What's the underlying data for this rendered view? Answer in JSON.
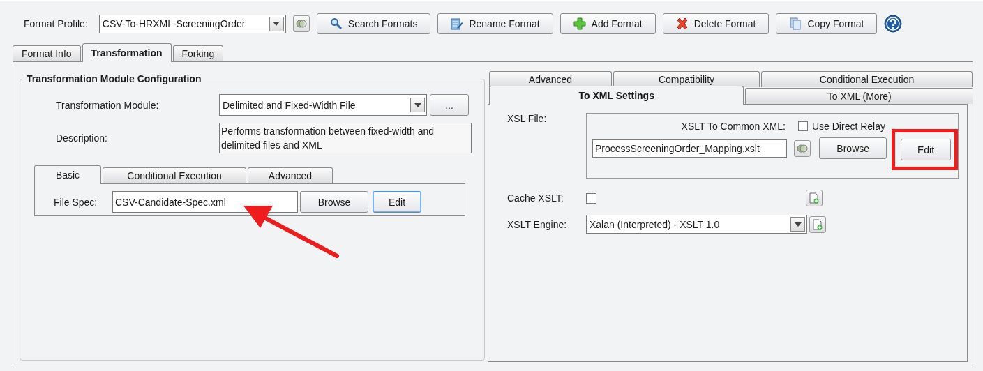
{
  "toolbar": {
    "profile_label": "Format Profile:",
    "profile_value": "CSV-To-HRXML-ScreeningOrder",
    "buttons": [
      {
        "kind": "search",
        "label": "Search Formats"
      },
      {
        "kind": "rename",
        "label": "Rename Format"
      },
      {
        "kind": "add",
        "label": "Add Format"
      },
      {
        "kind": "delete",
        "label": "Delete Format"
      },
      {
        "kind": "copy",
        "label": "Copy Format"
      }
    ]
  },
  "tabs": [
    {
      "label": "Format Info",
      "selected": false
    },
    {
      "label": "Transformation",
      "selected": true
    },
    {
      "label": "Forking",
      "selected": false
    }
  ],
  "module_config": {
    "title": "Transformation Module Configuration",
    "module_label": "Transformation Module:",
    "module_value": "Delimited and Fixed-Width File",
    "more_button": "...",
    "description_label": "Description:",
    "description": "Performs transformation between fixed-width and delimited files and XML",
    "subtabs": [
      {
        "label": "Basic",
        "selected": true
      },
      {
        "label": "Conditional Execution",
        "selected": false
      },
      {
        "label": "Advanced",
        "selected": false
      }
    ],
    "file_spec_label": "File Spec:",
    "file_spec_value": "CSV-Candidate-Spec.xml",
    "browse_button": "Browse",
    "edit_button": "Edit"
  },
  "settings": {
    "tab_rows": [
      [
        {
          "label": "Advanced",
          "selected": false
        },
        {
          "label": "Compatibility",
          "selected": false
        },
        {
          "label": "Conditional Execution",
          "selected": false
        }
      ],
      [
        {
          "label": "To XML Settings",
          "selected": true
        },
        {
          "label": "To XML (More)",
          "selected": false
        }
      ]
    ],
    "xsl_label": "XSL File:",
    "common_label": "XSLT To Common XML:",
    "direct_relay": {
      "label": "Use Direct Relay",
      "checked": false
    },
    "xsl_value": "ProcessScreeningOrder_Mapping.xslt",
    "browse_button": "Browse",
    "edit_button": "Edit",
    "cache_label": "Cache XSLT:",
    "cache_checked": false,
    "engine_label": "XSLT Engine:",
    "engine_value": "Xalan (Interpreted) - XSLT 1.0"
  }
}
